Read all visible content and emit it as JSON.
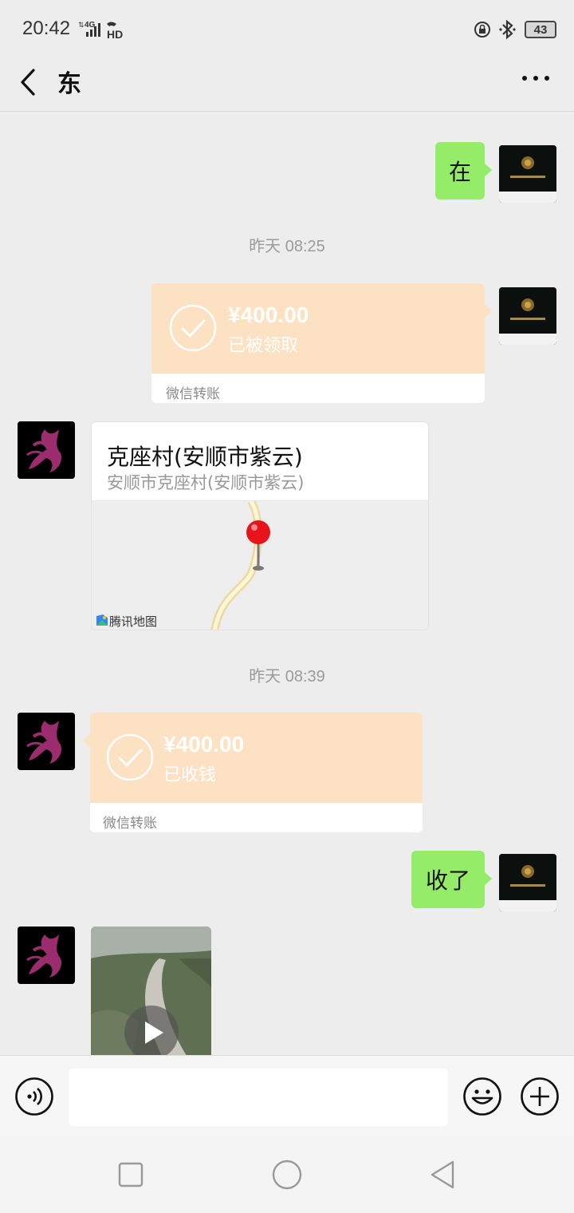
{
  "status_bar": {
    "time": "20:42",
    "network": "4G",
    "hd": "HD",
    "battery": "43"
  },
  "header": {
    "title": "东",
    "back_icon": "chevron-left-icon",
    "more_icon": "more-dots-icon"
  },
  "messages": {
    "msg1": {
      "sender": "self",
      "text": "在"
    },
    "ts1": "昨天 08:25",
    "transfer1": {
      "sender": "self",
      "amount": "¥400.00",
      "status": "已被领取",
      "footer": "微信转账"
    },
    "location": {
      "sender": "peer",
      "title": "克座村(安顺市紫云)",
      "subtitle": "安顺市克座村(安顺市紫云)",
      "map_brand": "腾讯地图"
    },
    "ts2": "昨天 08:39",
    "transfer2": {
      "sender": "peer",
      "amount": "¥400.00",
      "status": "已收钱",
      "footer": "微信转账"
    },
    "msg2": {
      "sender": "self",
      "text": "收了"
    },
    "video": {
      "sender": "peer",
      "icon": "play-icon"
    }
  },
  "input_bar": {
    "placeholder": "",
    "voice_icon": "voice-icon",
    "emoji_icon": "emoji-icon",
    "plus_icon": "plus-icon"
  },
  "colors": {
    "self_bubble": "#95ec69",
    "transfer_bg": "#fde1c3",
    "background": "#ededed"
  }
}
